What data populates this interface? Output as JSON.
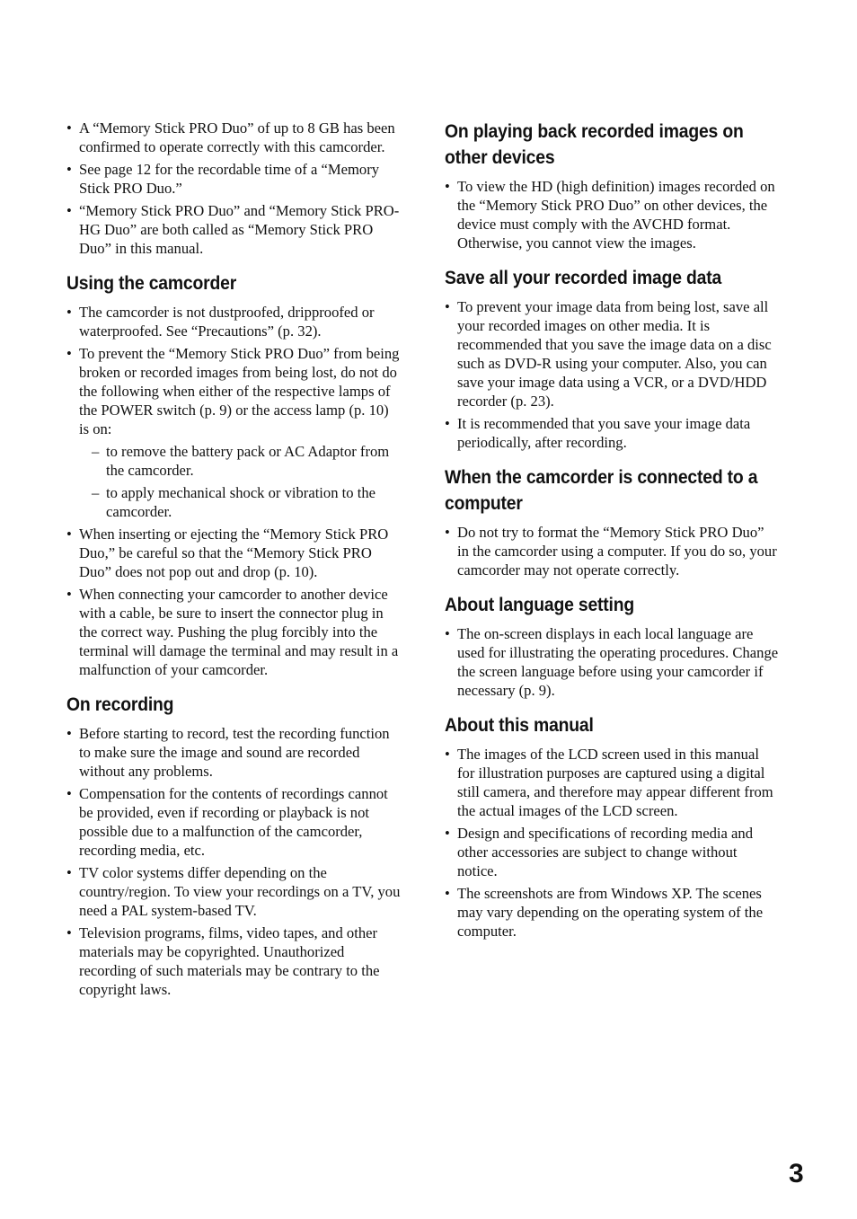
{
  "left_column": {
    "intro_bullets": [
      "A “Memory Stick PRO Duo” of up to 8 GB has been confirmed to operate correctly with this camcorder.",
      "See page 12 for the recordable time of a “Memory Stick PRO Duo.”",
      "“Memory Stick PRO Duo” and “Memory Stick PRO-HG Duo” are both called as “Memory Stick PRO Duo” in this manual."
    ],
    "using": {
      "heading": "Using the camcorder",
      "bullet1": "The camcorder is not dustproofed, dripproofed or waterproofed. See “Precautions” (p. 32).",
      "bullet2": "To prevent the “Memory Stick PRO Duo” from being broken or recorded images from being lost, do not do the following when either of the respective lamps of the POWER switch (p. 9) or the access lamp (p. 10) is on:",
      "sub_items": [
        "to remove the battery pack or AC Adaptor from the camcorder.",
        "to apply mechanical shock or vibration to the camcorder."
      ],
      "bullet3": "When inserting or ejecting the “Memory Stick PRO Duo,” be careful so that the “Memory Stick PRO Duo” does not pop out and drop (p. 10).",
      "bullet4": "When connecting your camcorder to another device with a cable, be sure to insert the connector plug in the correct way. Pushing the plug forcibly into the terminal will damage the terminal and may result in a malfunction of your camcorder."
    },
    "recording": {
      "heading": "On recording",
      "bullets": [
        "Before starting to record, test the recording function to make sure the image and sound are recorded without any problems.",
        "Compensation for the contents of recordings cannot be provided, even if recording or playback is not possible due to a malfunction of the camcorder, recording media, etc.",
        "TV color systems differ depending on the country/region. To view your recordings on a TV, you need a PAL system-based TV.",
        "Television programs, films, video tapes, and other materials may be copyrighted. Unauthorized recording of such materials may be contrary to the copyright laws."
      ]
    }
  },
  "right_column": {
    "playback": {
      "heading": "On playing back recorded images on other devices",
      "bullets": [
        "To view the HD (high definition) images recorded on the “Memory Stick PRO Duo” on other devices, the device must comply with the AVCHD format. Otherwise, you cannot view the images."
      ]
    },
    "save": {
      "heading": "Save all your recorded image data",
      "bullets": [
        "To prevent your image data from being lost, save all your recorded images on other media. It is recommended that you save the image data on a disc such as DVD-R using your computer. Also, you can save your image data using a VCR, or a DVD/HDD recorder (p. 23).",
        "It is recommended that you save your image data periodically, after recording."
      ]
    },
    "computer": {
      "heading": "When the camcorder is connected to a computer",
      "bullets": [
        "Do not try to format the “Memory Stick PRO Duo” in the camcorder using a computer. If you do so, your camcorder may not operate correctly."
      ]
    },
    "language": {
      "heading": "About language setting",
      "bullets": [
        "The on-screen displays in each local language are used for illustrating the operating procedures. Change the screen language before using your camcorder if necessary (p. 9)."
      ]
    },
    "manual": {
      "heading": "About this manual",
      "bullets": [
        "The images of the LCD screen used in this manual for illustration purposes are captured using a digital still camera, and therefore may appear different from the actual images of the LCD screen.",
        "Design and specifications of recording media and other accessories are subject to change without notice.",
        "The screenshots are from Windows XP. The scenes may vary depending on the operating system of the computer."
      ]
    }
  },
  "page_number": "3"
}
